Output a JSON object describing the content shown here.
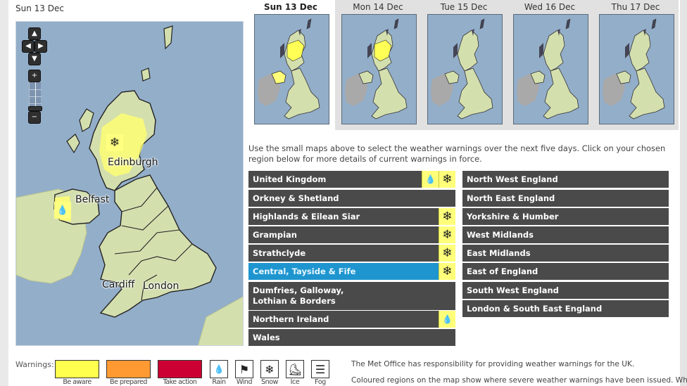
{
  "main_map": {
    "date": "Sun 13 Dec",
    "cities": {
      "edinburgh": "Edinburgh",
      "belfast": "Belfast",
      "cardiff": "Cardiff",
      "london": "London"
    },
    "controls": {
      "pan_up": "▲",
      "pan_left": "◀",
      "pan_right": "▶",
      "pan_down": "▼",
      "zoom_in": "+",
      "zoom_out": "−"
    },
    "warning_markers": [
      {
        "region": "Central, Tayside & Fife",
        "type": "snow",
        "glyph": "❄"
      },
      {
        "region": "Northern Ireland",
        "type": "rain",
        "glyph": "💧"
      }
    ]
  },
  "day_tabs": [
    {
      "label": "Sun 13 Dec",
      "active": true,
      "yellow_regions": [
        "scotland-central",
        "northern-ireland"
      ]
    },
    {
      "label": "Mon 14 Dec",
      "active": false,
      "yellow_regions": [
        "scotland-central"
      ]
    },
    {
      "label": "Tue 15 Dec",
      "active": false,
      "yellow_regions": []
    },
    {
      "label": "Wed 16 Dec",
      "active": false,
      "yellow_regions": []
    },
    {
      "label": "Thu 17 Dec",
      "active": false,
      "yellow_regions": []
    }
  ],
  "intro_text": "Use the small maps above to select the weather warnings over the next five days. Click on your chosen region below for more details of current warnings in force.",
  "regions_left": [
    {
      "name": "United Kingdom",
      "icons": [
        "rain",
        "snow"
      ],
      "selected": false
    },
    {
      "name": "Orkney & Shetland",
      "icons": [],
      "selected": false
    },
    {
      "name": "Highlands & Eilean Siar",
      "icons": [
        "snow"
      ],
      "selected": false
    },
    {
      "name": "Grampian",
      "icons": [
        "snow"
      ],
      "selected": false
    },
    {
      "name": "Strathclyde",
      "icons": [
        "snow"
      ],
      "selected": false
    },
    {
      "name": "Central, Tayside & Fife",
      "icons": [
        "snow"
      ],
      "selected": true
    },
    {
      "name": "Dumfries, Galloway, Lothian & Borders",
      "icons": [],
      "selected": false
    },
    {
      "name": "Northern Ireland",
      "icons": [
        "rain"
      ],
      "selected": false
    },
    {
      "name": "Wales",
      "icons": [],
      "selected": false
    }
  ],
  "regions_right": [
    {
      "name": "North West England",
      "icons": []
    },
    {
      "name": "North East England",
      "icons": []
    },
    {
      "name": "Yorkshire & Humber",
      "icons": []
    },
    {
      "name": "West Midlands",
      "icons": []
    },
    {
      "name": "East Midlands",
      "icons": []
    },
    {
      "name": "East of England",
      "icons": []
    },
    {
      "name": "South West England",
      "icons": []
    },
    {
      "name": "London & South East England",
      "icons": []
    }
  ],
  "icon_glyphs": {
    "rain": "💧",
    "snow": "❄",
    "wind": "⚑",
    "ice": "⛸",
    "fog": "☰"
  },
  "legend": {
    "title": "Warnings:",
    "severities": [
      {
        "label": "Be aware",
        "color": "#ffff4d"
      },
      {
        "label": "Be prepared",
        "color": "#ff9a33"
      },
      {
        "label": "Take action",
        "color": "#cc0033"
      }
    ],
    "types": [
      {
        "label": "Rain",
        "glyph": "💧"
      },
      {
        "label": "Wind",
        "glyph": "⚑"
      },
      {
        "label": "Snow",
        "glyph": "❄"
      },
      {
        "label": "Ice",
        "glyph": "⛸"
      },
      {
        "label": "Fog",
        "glyph": "☰"
      }
    ]
  },
  "info": {
    "line1": "The Met Office has responsibility for providing weather warnings for the UK.",
    "line2": "Coloured regions on the map show where severe weather warnings have been issued. When"
  },
  "colors": {
    "sea": "#93aec9",
    "land": "#d4dfae",
    "ireland": "#a9a9a9",
    "warning_yellow": "#ffff7a",
    "region_bg": "#4a4a4a",
    "region_selected": "#1e95cf"
  }
}
